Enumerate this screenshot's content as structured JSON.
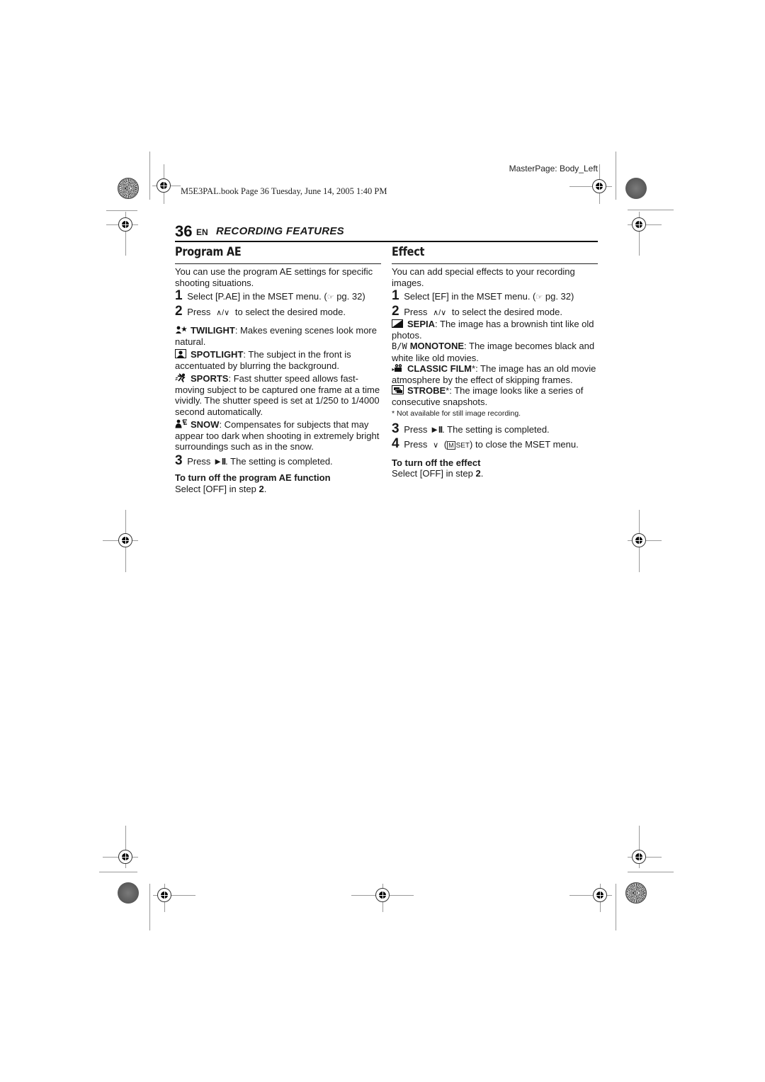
{
  "print_marks": {
    "masterpage_label": "MasterPage: Body_Left",
    "book_line": "M5E3PAL.book  Page 36  Tuesday, June 14, 2005  1:40 PM"
  },
  "header": {
    "page_number": "36",
    "language": "EN",
    "section_title": "RECORDING FEATURES"
  },
  "program_ae": {
    "title": "Program AE",
    "intro": "You can use the program AE settings for specific shooting situations.",
    "steps": [
      {
        "num": "1",
        "text_before": "Select [P.AE] in the MSET menu. (",
        "ref_icon": "☞",
        "ref": " pg. 32)"
      },
      {
        "num": "2",
        "text_before": "Press",
        "arrows": "∧/∨",
        "text_after": "to select the desired mode."
      },
      {
        "num": "3",
        "text_before": "Press",
        "button": "►II",
        "text_after": ". The setting is completed."
      }
    ],
    "modes": [
      {
        "icon": "twilight-icon",
        "name": "TWILIGHT",
        "desc": ": Makes evening scenes look more natural."
      },
      {
        "icon": "spotlight-icon",
        "name": "SPOTLIGHT",
        "desc": ": The subject in the front is accentuated by blurring the background."
      },
      {
        "icon": "sports-icon",
        "name": "SPORTS",
        "desc": ": Fast shutter speed allows fast-moving subject to be captured one frame at a time vividly. The shutter speed is set at 1/250 to 1/4000 second automatically."
      },
      {
        "icon": "snow-icon",
        "name": "SNOW",
        "desc": ": Compensates for subjects that may appear too dark when shooting in extremely bright surroundings such as in the snow."
      }
    ],
    "turn_off_heading": "To turn off the program AE function",
    "turn_off_text": "Select [OFF] in step ",
    "turn_off_step": "2",
    "turn_off_end": "."
  },
  "effect": {
    "title": "Effect",
    "intro": "You can add special effects to your recording images.",
    "steps": [
      {
        "num": "1",
        "text_before": "Select [EF] in the MSET menu. (",
        "ref_icon": "☞",
        "ref": " pg. 32)"
      },
      {
        "num": "2",
        "text_before": "Press",
        "arrows": "∧/∨",
        "text_after": "to select the desired mode."
      },
      {
        "num": "3",
        "text_before": "Press",
        "button": "►II",
        "text_after": ". The setting is completed."
      },
      {
        "num": "4",
        "text_before": "Press",
        "arrows": "∨",
        "mset_open": "(",
        "mset_m": "M",
        "mset_label": "SET",
        "mset_close": ")",
        "text_after": " to close the MSET menu."
      }
    ],
    "modes": [
      {
        "icon": "sepia-icon",
        "name": "SEPIA",
        "desc": ": The image has a brownish tint like old photos."
      },
      {
        "icon": "monotone-icon",
        "icon_text": "B/W",
        "name": "MONOTONE",
        "desc": ": The image becomes black and white like old movies."
      },
      {
        "icon": "classic-film-icon",
        "name": "CLASSIC FILM",
        "asterisk": "*",
        "desc": ": The image has an old movie atmosphere by the effect of skipping frames."
      },
      {
        "icon": "strobe-icon",
        "name": "STROBE",
        "asterisk": "*",
        "desc": ": The image looks like a series of consecutive snapshots."
      }
    ],
    "footnote": "*  Not available for still image recording.",
    "turn_off_heading": "To turn off the effect",
    "turn_off_text": "Select [OFF] in step ",
    "turn_off_step": "2",
    "turn_off_end": "."
  }
}
